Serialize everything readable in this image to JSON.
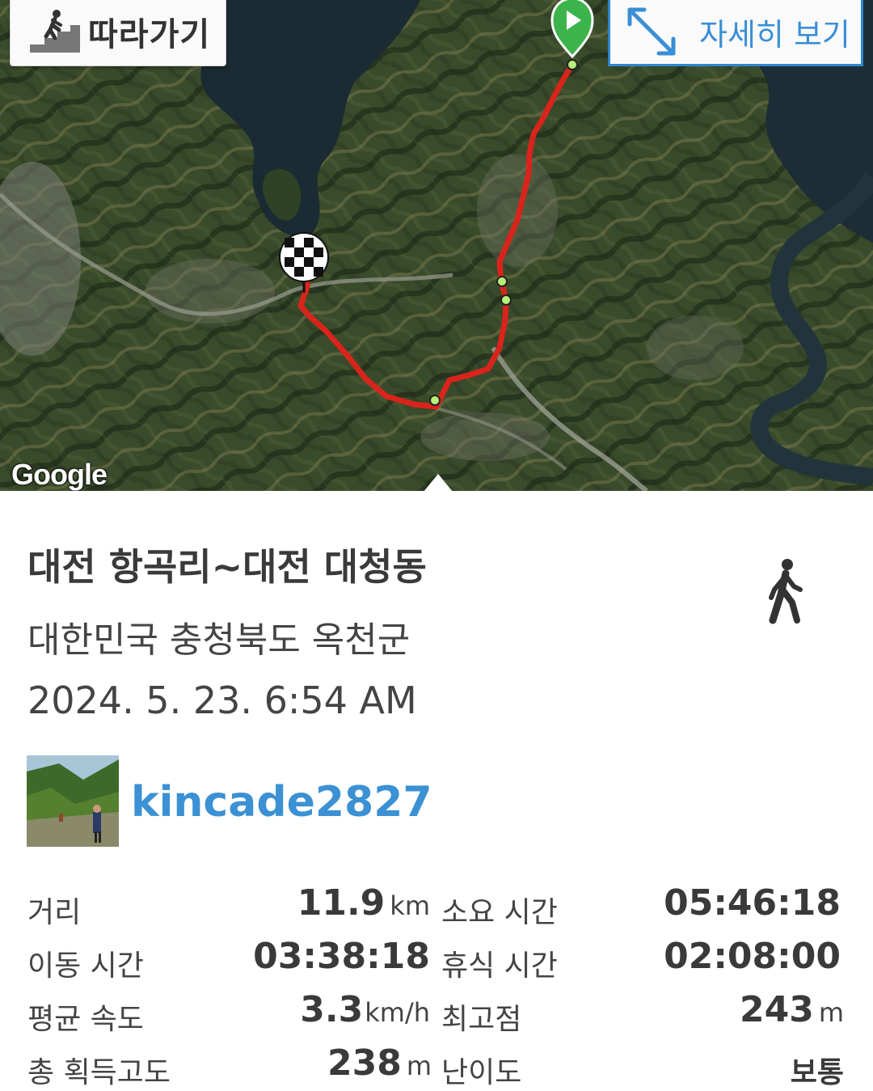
{
  "map": {
    "follow_label": "따라가기",
    "detail_label": "자세히 보기",
    "provider": "Google",
    "route_color": "#d9241c",
    "start_marker_color": "#3cb44b",
    "icons": [
      "walker-stairs-icon",
      "expand-arrows-icon",
      "play-start-icon",
      "checkered-finish-flag-icon"
    ]
  },
  "track": {
    "title": "대전 항곡리~대전 대청동",
    "region": "대한민국 충청북도 옥천군",
    "datetime": "2024. 5. 23. 6:54 AM",
    "activity_icon": "walking-person-icon",
    "user": {
      "name": "kincade2827",
      "name_color": "#3b91d3"
    }
  },
  "stats": {
    "distance": {
      "label": "거리",
      "value": "11.9",
      "unit": "km"
    },
    "total_time": {
      "label": "소요 시간",
      "value": "05:46:18"
    },
    "moving_time": {
      "label": "이동 시간",
      "value": "03:38:18"
    },
    "rest_time": {
      "label": "휴식 시간",
      "value": "02:08:00"
    },
    "avg_speed": {
      "label": "평균 속도",
      "value": "3.3",
      "unit": "km/h"
    },
    "max_elevation": {
      "label": "최고점",
      "value": "243",
      "unit": "m"
    },
    "total_ascent": {
      "label": "총 획득고도",
      "value": "238",
      "unit": "m"
    },
    "difficulty": {
      "label": "난이도",
      "value": "보통"
    }
  }
}
